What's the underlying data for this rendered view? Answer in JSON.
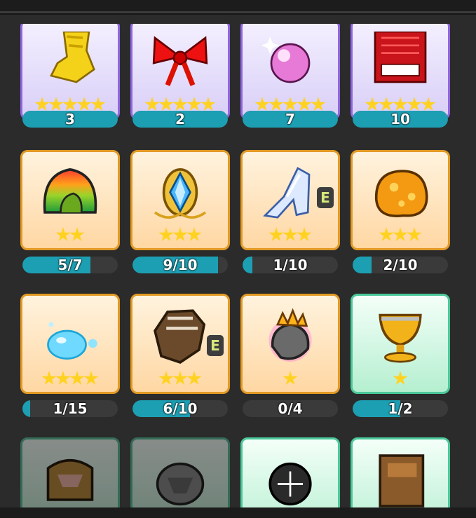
{
  "items": [
    {
      "name": "yellow-scroll-item",
      "rarity": "purple",
      "stars": 5,
      "progress": "3",
      "fill": 1.0,
      "equipped": false
    },
    {
      "name": "red-ribbon-item",
      "rarity": "purple",
      "stars": 5,
      "progress": "2",
      "fill": 1.0,
      "equipped": false
    },
    {
      "name": "pink-orb-item",
      "rarity": "purple",
      "stars": 5,
      "progress": "7",
      "fill": 1.0,
      "equipped": false
    },
    {
      "name": "red-banner-item",
      "rarity": "purple",
      "stars": 5,
      "progress": "10",
      "fill": 1.0,
      "equipped": false
    },
    {
      "name": "rainbow-shell-item",
      "rarity": "orange",
      "stars": 2,
      "progress": "5/7",
      "fill": 0.714,
      "equipped": false
    },
    {
      "name": "crystal-pendant-item",
      "rarity": "orange",
      "stars": 3,
      "progress": "9/10",
      "fill": 0.9,
      "equipped": false
    },
    {
      "name": "glass-slipper-item",
      "rarity": "orange",
      "stars": 3,
      "progress": "1/10",
      "fill": 0.1,
      "equipped": true
    },
    {
      "name": "orange-rock-item",
      "rarity": "orange",
      "stars": 3,
      "progress": "2/10",
      "fill": 0.2,
      "equipped": false
    },
    {
      "name": "water-bubble-item",
      "rarity": "orange",
      "stars": 4,
      "progress": "1/15",
      "fill": 0.067,
      "equipped": false
    },
    {
      "name": "leather-glove-item",
      "rarity": "orange",
      "stars": 3,
      "progress": "6/10",
      "fill": 0.6,
      "equipped": true
    },
    {
      "name": "crowned-rock-item",
      "rarity": "orange",
      "stars": 1,
      "progress": "0/4",
      "fill": 0.0,
      "equipped": false
    },
    {
      "name": "golden-chalice-item",
      "rarity": "green",
      "stars": 1,
      "progress": "1/2",
      "fill": 0.5,
      "equipped": false
    },
    {
      "name": "treasure-chest-item",
      "rarity": "green",
      "stars": 0,
      "progress": "",
      "fill": 0,
      "equipped": false,
      "dim": true
    },
    {
      "name": "stone-coin-item",
      "rarity": "green",
      "stars": 0,
      "progress": "",
      "fill": 0,
      "equipped": false,
      "dim": true
    },
    {
      "name": "dark-sphere-item",
      "rarity": "green",
      "stars": 0,
      "progress": "",
      "fill": 0,
      "equipped": false
    },
    {
      "name": "old-book-item",
      "rarity": "green",
      "stars": 0,
      "progress": "",
      "fill": 0,
      "equipped": false
    }
  ],
  "equip_badge": "E"
}
